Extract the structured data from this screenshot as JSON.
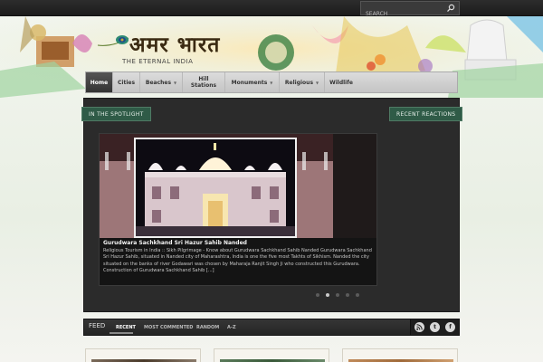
{
  "search": {
    "placeholder": "SEARCH"
  },
  "logo": {
    "title": "अमर भारत",
    "tagline": "THE ETERNAL INDIA"
  },
  "nav": {
    "items": [
      {
        "label": "Home"
      },
      {
        "label": "Cities"
      },
      {
        "label": "Beaches"
      },
      {
        "label": "Hill Stations"
      },
      {
        "label": "Monuments"
      },
      {
        "label": "Religious"
      },
      {
        "label": "Wildlife"
      }
    ]
  },
  "sections": {
    "spotlight": "IN THE SPOTLIGHT",
    "reactions": "RECENT REACTIONS"
  },
  "slide": {
    "title": "Gurudwara Sachkhand Sri Hazur Sahib Nanded",
    "text": "Religious Tourism in India :: Sikh Pilgrimage - Know about Gurudwara Sachkhand Sahib Nanded Gurudwara Sachkhand Sri Hazur Sahib,  situated in Nanded city of Maharashtra, India is one the five most Takhts of Sikhism. Nanded the city situated on the banks of river Godawari was chosen  by Maharaja Ranjit Singh Ji who constructed this Gurudwara. Construction of Gurudwara Sachkhand Sahib [...]",
    "active_index": 1,
    "count": 5
  },
  "feed": {
    "title": "FEED",
    "tabs": [
      "RECENT",
      "MOST COMMENTED",
      "RANDOM",
      "A-Z"
    ],
    "active_tab": "RECENT",
    "icons": [
      "rss-icon",
      "twitter-icon",
      "facebook-icon"
    ]
  },
  "colors": {
    "accent_green": "#2f5b47",
    "panel": "#2b2b2b",
    "topbar": "#1c1c1c"
  }
}
